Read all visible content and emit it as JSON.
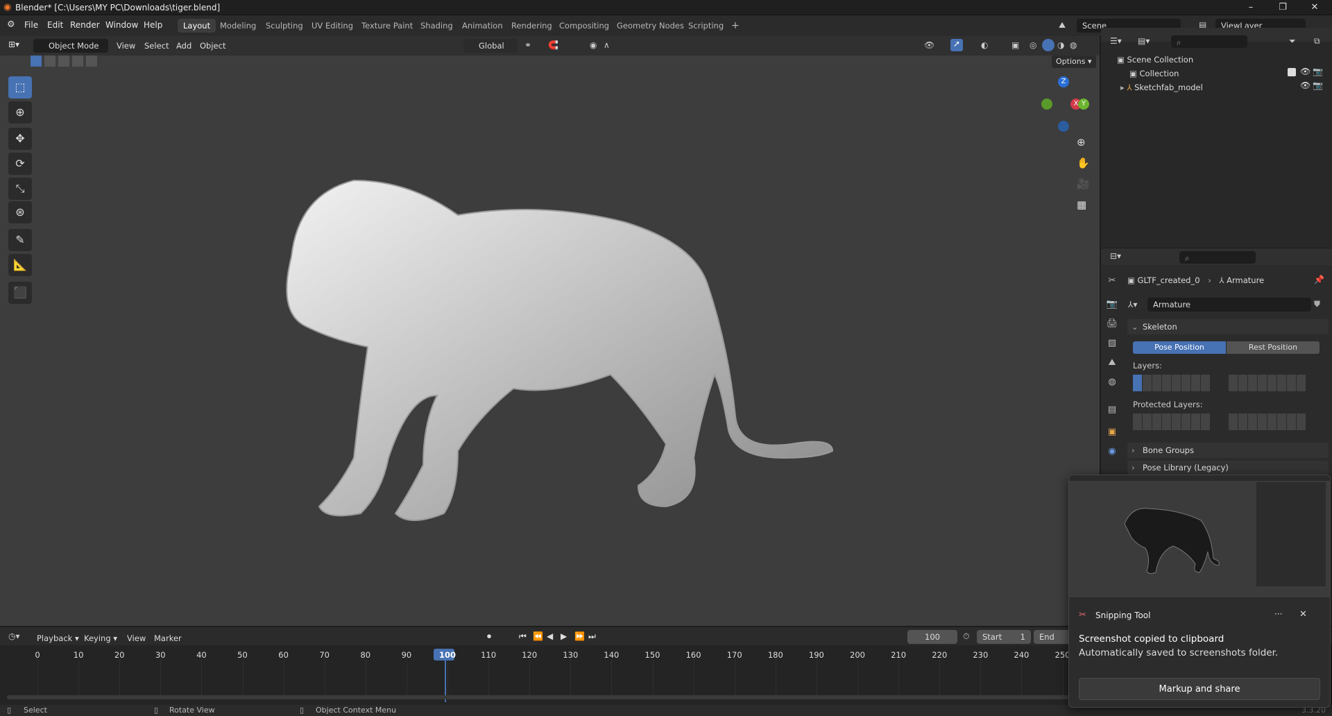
{
  "window": {
    "title": "Blender* [C:\\Users\\MY PC\\Downloads\\tiger.blend]",
    "min": "–",
    "max": "❐",
    "close": "✕"
  },
  "menu": [
    "File",
    "Edit",
    "Render",
    "Window",
    "Help"
  ],
  "workspaces": [
    "Layout",
    "Modeling",
    "Sculpting",
    "UV Editing",
    "Texture Paint",
    "Shading",
    "Animation",
    "Rendering",
    "Compositing",
    "Geometry Nodes",
    "Scripting",
    "+"
  ],
  "scene": {
    "label": "Scene",
    "viewlayer": "ViewLayer"
  },
  "viewport_header": {
    "mode": "Object Mode",
    "view": "View",
    "select": "Select",
    "add": "Add",
    "object": "Object",
    "orientation": "Global",
    "options": "Options"
  },
  "gizmo": {
    "z": "Z",
    "x": "X",
    "y": "Y"
  },
  "outliner": {
    "root": "Scene Collection",
    "collection": "Collection",
    "object": "Sketchfab_model"
  },
  "properties": {
    "breadcrumb_obj": "GLTF_created_0",
    "breadcrumb_data": "Armature",
    "data_name": "Armature",
    "skeleton": "Skeleton",
    "pose_position": "Pose Position",
    "rest_position": "Rest Position",
    "layers": "Layers:",
    "protected_layers": "Protected Layers:",
    "bone_groups": "Bone Groups",
    "pose_library": "Pose Library (Legacy)"
  },
  "timeline": {
    "playback": "Playback",
    "keying": "Keying",
    "view": "View",
    "marker": "Marker",
    "current_frame": "100",
    "start_label": "Start",
    "start": "1",
    "end_label": "End",
    "ticks": [
      "0",
      "10",
      "20",
      "30",
      "40",
      "50",
      "60",
      "70",
      "80",
      "90",
      "100",
      "110",
      "120",
      "130",
      "140",
      "150",
      "160",
      "170",
      "180",
      "190",
      "200",
      "210",
      "220",
      "230",
      "240",
      "250"
    ]
  },
  "status": {
    "select": "Select",
    "rotate": "Rotate View",
    "context": "Object Context Menu",
    "version": "3.3.20"
  },
  "toast": {
    "app": "Snipping Tool",
    "title": "Screenshot copied to clipboard",
    "body": "Automatically saved to screenshots folder.",
    "button": "Markup and share",
    "more": "···",
    "close": "✕"
  },
  "colors": {
    "accent": "#4772b3",
    "active_frame": "#4772b3"
  }
}
